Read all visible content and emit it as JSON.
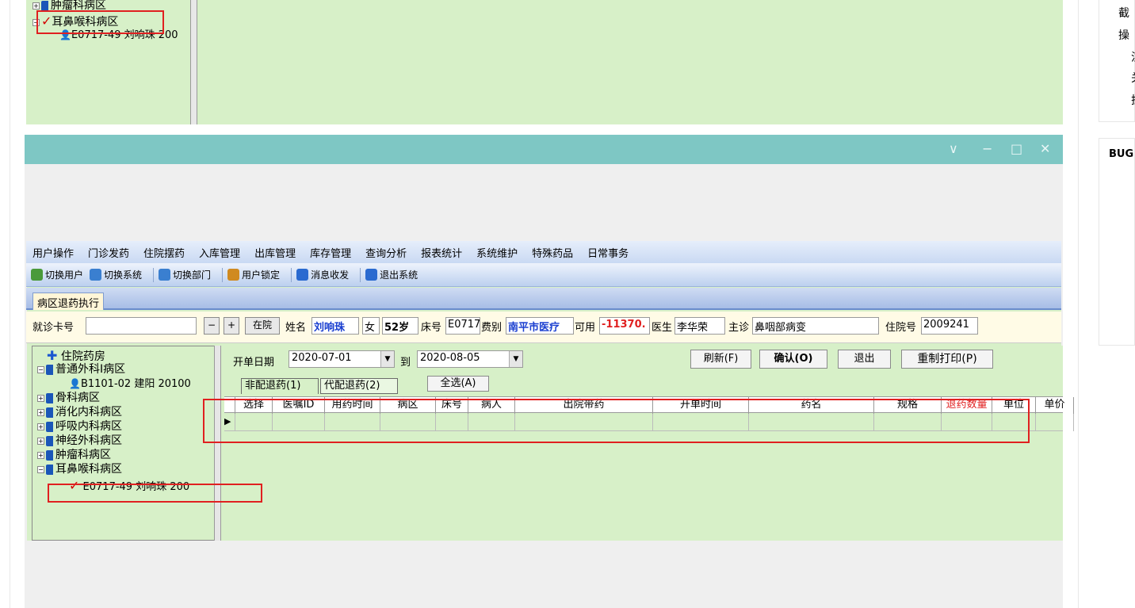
{
  "top_tree": {
    "item_tumor": "肿瘤科病区",
    "item_ent": "耳鼻喉科病区",
    "patient": "E0717-49 刘响珠 200"
  },
  "main_window": {
    "menu": [
      "用户操作",
      "门诊发药",
      "住院摆药",
      "入库管理",
      "出库管理",
      "库存管理",
      "查询分析",
      "报表统计",
      "系统维护",
      "特殊药品",
      "日常事务"
    ],
    "toolbar": [
      {
        "label": "切换用户",
        "icon": "users-icon",
        "color": "#4a9a3a"
      },
      {
        "label": "切换系统",
        "icon": "switch-system-icon",
        "color": "#3a7fd0"
      },
      {
        "label": "切换部门",
        "icon": "switch-dept-icon",
        "color": "#3a7fd0"
      },
      {
        "label": "用户锁定",
        "icon": "lock-user-icon",
        "color": "#d08a20"
      },
      {
        "label": "消息收发",
        "icon": "info-icon",
        "color": "#2a6ad0"
      },
      {
        "label": "退出系统",
        "icon": "exit-icon",
        "color": "#2a6ad0"
      }
    ],
    "tab_label": "病区退药执行",
    "info": {
      "card_label": "就诊卡号",
      "card_value": "",
      "minus": "−",
      "plus": "+",
      "status_btn": "在院",
      "name_label": "姓名",
      "name_value": "刘响珠",
      "gender": "女",
      "age": "52岁",
      "bed_label": "床号",
      "bed_value": "E0717",
      "fee_label": "费别",
      "fee_value": "南平市医疗",
      "avail_label": "可用",
      "avail_value": "-11370.",
      "doctor_label": "医生",
      "doctor_value": "李华荣",
      "diag_label": "主诊",
      "diag_value": "鼻咽部病变",
      "inpatient_label": "住院号",
      "inpatient_value": "2009241"
    },
    "tree": [
      {
        "label": "住院药房",
        "type": "root"
      },
      {
        "label": "普通外科Ⅰ病区",
        "type": "ward",
        "expanded": true
      },
      {
        "label": "B1101-02 建阳 20100",
        "type": "patient"
      },
      {
        "label": "骨科病区",
        "type": "ward"
      },
      {
        "label": "消化内科病区",
        "type": "ward"
      },
      {
        "label": "呼吸内科病区",
        "type": "ward"
      },
      {
        "label": "神经外科病区",
        "type": "ward"
      },
      {
        "label": "肿瘤科病区",
        "type": "ward"
      },
      {
        "label": "耳鼻喉科病区",
        "type": "ward",
        "expanded": true
      },
      {
        "label": "E0717-49 刘响珠 200",
        "type": "checked"
      }
    ],
    "filter": {
      "date_label": "开单日期",
      "date_from": "2020-07-01",
      "to_label": "到",
      "date_to": "2020-08-05",
      "refresh": "刷新(F)",
      "confirm": "确认(O)",
      "exit": "退出",
      "reprint": "重制打印(P)"
    },
    "subtabs": [
      "非配退药(1)",
      "代配退药(2)"
    ],
    "select_all": "全选(A)",
    "columns": [
      "选择",
      "医嘱ID",
      "用药时间",
      "病区",
      "床号",
      "病人",
      "出院带药",
      "开单时间",
      "药名",
      "规格",
      "退药数量",
      "单位",
      "单价"
    ],
    "highlight_column": "退药数量",
    "accent_color": "#e02020"
  },
  "side_text": {
    "line1": "截",
    "line2": "操",
    "line3": "注",
    "line4": "关",
    "line5": "挂",
    "bug_label": "BUG"
  }
}
